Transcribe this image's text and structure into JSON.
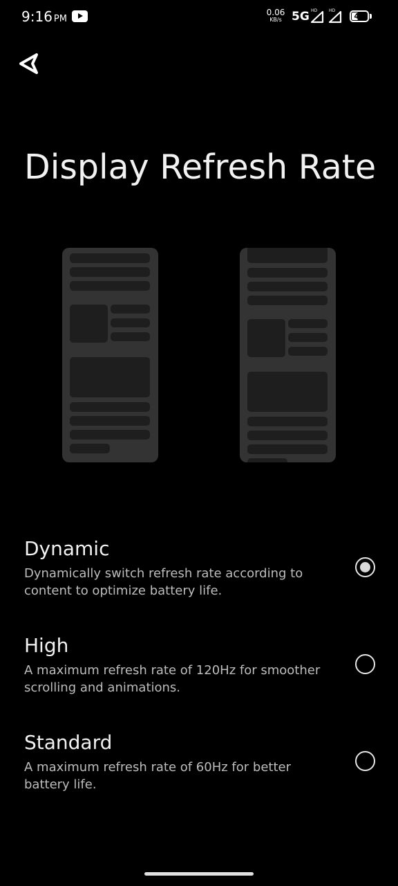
{
  "status_bar": {
    "time": "9:16",
    "ampm": "PM",
    "net_speed": "0.06",
    "net_speed_unit": "KB/s",
    "network_type": "5G",
    "sim1_label": "HD",
    "sim2_label": "HD",
    "battery_level": "40",
    "battery_fraction": 0.4,
    "notification_icon": "youtube-icon"
  },
  "header": {
    "back_icon": "back-triangle-icon",
    "title": "Display Refresh Rate"
  },
  "illustration": {
    "left_phone": "phone-preview",
    "right_phone": "phone-preview-scrolled"
  },
  "options": [
    {
      "title": "Dynamic",
      "description": "Dynamically switch refresh rate according to content to optimize battery life.",
      "selected": true
    },
    {
      "title": "High",
      "description": "A maximum refresh rate of 120Hz for smoother scrolling and animations.",
      "selected": false
    },
    {
      "title": "Standard",
      "description": "A maximum refresh rate of 60Hz for better battery life.",
      "selected": false
    }
  ],
  "colors": {
    "background": "#000000",
    "text_primary": "#f2f2f2",
    "text_secondary": "#bdbdbd",
    "phone_frame": "#333333",
    "phone_block": "#1e1e1e"
  }
}
